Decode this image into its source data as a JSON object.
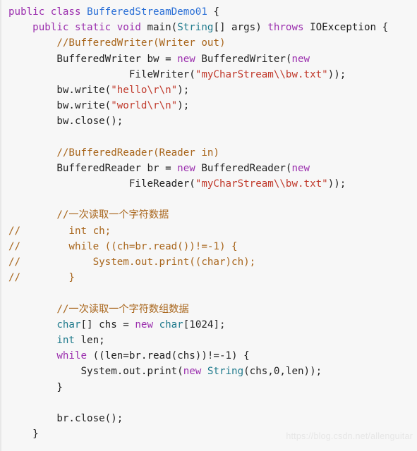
{
  "viewer": {
    "background_color": "#f7f7f7",
    "language": "java",
    "font_size_px": 14.2,
    "line_height_px": 22.2
  },
  "theme": {
    "keyword_color": "#9b2fae",
    "type_color": "#1f7a8c",
    "class_color": "#2a6fd6",
    "string_color": "#c0392b",
    "comment_color": "#a8651b",
    "plain_color": "#222222",
    "watermark_color": "#e6e6e6"
  },
  "watermark": {
    "text": "https://blog.csdn.net/allenguitar"
  },
  "code": {
    "lines": [
      {
        "n": 1,
        "tokens": [
          {
            "t": "public",
            "c": "kw"
          },
          {
            "t": " ",
            "c": "pln"
          },
          {
            "t": "class",
            "c": "kw"
          },
          {
            "t": " ",
            "c": "pln"
          },
          {
            "t": "BufferedStreamDemo01",
            "c": "cls"
          },
          {
            "t": " {",
            "c": "pln"
          }
        ]
      },
      {
        "n": 2,
        "tokens": [
          {
            "t": "    ",
            "c": "pln"
          },
          {
            "t": "public",
            "c": "kw"
          },
          {
            "t": " ",
            "c": "pln"
          },
          {
            "t": "static",
            "c": "kw"
          },
          {
            "t": " ",
            "c": "pln"
          },
          {
            "t": "void",
            "c": "kw"
          },
          {
            "t": " main(",
            "c": "pln"
          },
          {
            "t": "String",
            "c": "type"
          },
          {
            "t": "[] args) ",
            "c": "pln"
          },
          {
            "t": "throws",
            "c": "kw"
          },
          {
            "t": " IOException {",
            "c": "pln"
          }
        ]
      },
      {
        "n": 3,
        "tokens": [
          {
            "t": "        ",
            "c": "pln"
          },
          {
            "t": "//BufferedWriter(Writer out)",
            "c": "cmt"
          }
        ]
      },
      {
        "n": 4,
        "tokens": [
          {
            "t": "        BufferedWriter bw = ",
            "c": "pln"
          },
          {
            "t": "new",
            "c": "kw"
          },
          {
            "t": " BufferedWriter(",
            "c": "pln"
          },
          {
            "t": "new",
            "c": "kw"
          }
        ]
      },
      {
        "n": 5,
        "tokens": [
          {
            "t": "                    FileWriter(",
            "c": "pln"
          },
          {
            "t": "\"myCharStream\\\\bw.txt\"",
            "c": "str"
          },
          {
            "t": "));",
            "c": "pln"
          }
        ]
      },
      {
        "n": 6,
        "tokens": [
          {
            "t": "        bw.write(",
            "c": "pln"
          },
          {
            "t": "\"hello\\r\\n\"",
            "c": "str"
          },
          {
            "t": ");",
            "c": "pln"
          }
        ]
      },
      {
        "n": 7,
        "tokens": [
          {
            "t": "        bw.write(",
            "c": "pln"
          },
          {
            "t": "\"world\\r\\n\"",
            "c": "str"
          },
          {
            "t": ");",
            "c": "pln"
          }
        ]
      },
      {
        "n": 8,
        "tokens": [
          {
            "t": "        bw.close();",
            "c": "pln"
          }
        ]
      },
      {
        "n": 9,
        "tokens": [
          {
            "t": "",
            "c": "pln"
          }
        ]
      },
      {
        "n": 10,
        "tokens": [
          {
            "t": "        ",
            "c": "pln"
          },
          {
            "t": "//BufferedReader(Reader in)",
            "c": "cmt"
          }
        ]
      },
      {
        "n": 11,
        "tokens": [
          {
            "t": "        BufferedReader br = ",
            "c": "pln"
          },
          {
            "t": "new",
            "c": "kw"
          },
          {
            "t": " BufferedReader(",
            "c": "pln"
          },
          {
            "t": "new",
            "c": "kw"
          }
        ]
      },
      {
        "n": 12,
        "tokens": [
          {
            "t": "                    FileReader(",
            "c": "pln"
          },
          {
            "t": "\"myCharStream\\\\bw.txt\"",
            "c": "str"
          },
          {
            "t": "));",
            "c": "pln"
          }
        ]
      },
      {
        "n": 13,
        "tokens": [
          {
            "t": "",
            "c": "pln"
          }
        ]
      },
      {
        "n": 14,
        "tokens": [
          {
            "t": "        ",
            "c": "pln"
          },
          {
            "t": "//一次读取一个字符数据",
            "c": "cmt"
          }
        ]
      },
      {
        "n": 15,
        "tokens": [
          {
            "t": "//        int ch;",
            "c": "cmt"
          }
        ]
      },
      {
        "n": 16,
        "tokens": [
          {
            "t": "//        while ((ch=br.read())!=-1) {",
            "c": "cmt"
          }
        ]
      },
      {
        "n": 17,
        "tokens": [
          {
            "t": "//            System.out.print((char)ch);",
            "c": "cmt"
          }
        ]
      },
      {
        "n": 18,
        "tokens": [
          {
            "t": "//        }",
            "c": "cmt"
          }
        ]
      },
      {
        "n": 19,
        "tokens": [
          {
            "t": "",
            "c": "pln"
          }
        ]
      },
      {
        "n": 20,
        "tokens": [
          {
            "t": "        ",
            "c": "pln"
          },
          {
            "t": "//一次读取一个字符数组数据",
            "c": "cmt"
          }
        ]
      },
      {
        "n": 21,
        "tokens": [
          {
            "t": "        ",
            "c": "pln"
          },
          {
            "t": "char",
            "c": "type"
          },
          {
            "t": "[] chs = ",
            "c": "pln"
          },
          {
            "t": "new",
            "c": "kw"
          },
          {
            "t": " ",
            "c": "pln"
          },
          {
            "t": "char",
            "c": "type"
          },
          {
            "t": "[1024];",
            "c": "pln"
          }
        ]
      },
      {
        "n": 22,
        "tokens": [
          {
            "t": "        ",
            "c": "pln"
          },
          {
            "t": "int",
            "c": "type"
          },
          {
            "t": " len;",
            "c": "pln"
          }
        ]
      },
      {
        "n": 23,
        "tokens": [
          {
            "t": "        ",
            "c": "pln"
          },
          {
            "t": "while",
            "c": "kw"
          },
          {
            "t": " ((len=br.read(chs))!=-1) {",
            "c": "pln"
          }
        ]
      },
      {
        "n": 24,
        "tokens": [
          {
            "t": "            System.out.print(",
            "c": "pln"
          },
          {
            "t": "new",
            "c": "kw"
          },
          {
            "t": " ",
            "c": "pln"
          },
          {
            "t": "String",
            "c": "type"
          },
          {
            "t": "(chs,0,len));",
            "c": "pln"
          }
        ]
      },
      {
        "n": 25,
        "tokens": [
          {
            "t": "        }",
            "c": "pln"
          }
        ]
      },
      {
        "n": 26,
        "tokens": [
          {
            "t": "",
            "c": "pln"
          }
        ]
      },
      {
        "n": 27,
        "tokens": [
          {
            "t": "        br.close();",
            "c": "pln"
          }
        ]
      },
      {
        "n": 28,
        "tokens": [
          {
            "t": "    }",
            "c": "pln"
          }
        ]
      }
    ]
  }
}
